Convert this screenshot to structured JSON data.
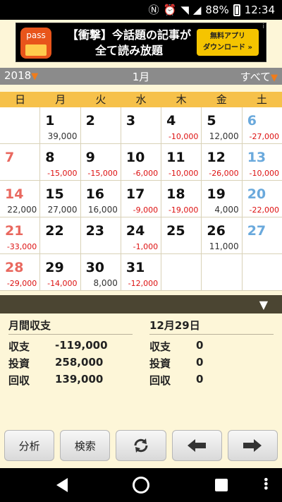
{
  "status": {
    "battery": "88%",
    "time": "12:34"
  },
  "ad": {
    "logo_text": "pass",
    "line1": "【衝撃】今話題の記事が",
    "line2": "全て読み放題",
    "button_line1": "無料アプリ",
    "button_line2": "ダウンロード »",
    "info": "i"
  },
  "header": {
    "year": "2018",
    "month": "1月",
    "filter": "すべて"
  },
  "weekdays": [
    "日",
    "月",
    "火",
    "水",
    "木",
    "金",
    "土"
  ],
  "calendar": [
    [
      {
        "day": "",
        "amount": ""
      },
      {
        "day": "1",
        "amount": "39,000"
      },
      {
        "day": "2",
        "amount": ""
      },
      {
        "day": "3",
        "amount": ""
      },
      {
        "day": "4",
        "amount": "-10,000"
      },
      {
        "day": "5",
        "amount": "12,000"
      },
      {
        "day": "6",
        "amount": "-27,000"
      }
    ],
    [
      {
        "day": "7",
        "amount": ""
      },
      {
        "day": "8",
        "amount": "-15,000"
      },
      {
        "day": "9",
        "amount": "-15,000"
      },
      {
        "day": "10",
        "amount": "-6,000"
      },
      {
        "day": "11",
        "amount": "-10,000"
      },
      {
        "day": "12",
        "amount": "-26,000"
      },
      {
        "day": "13",
        "amount": "-10,000"
      }
    ],
    [
      {
        "day": "14",
        "amount": "22,000"
      },
      {
        "day": "15",
        "amount": "27,000"
      },
      {
        "day": "16",
        "amount": "16,000"
      },
      {
        "day": "17",
        "amount": "-9,000"
      },
      {
        "day": "18",
        "amount": "-19,000"
      },
      {
        "day": "19",
        "amount": "4,000"
      },
      {
        "day": "20",
        "amount": "-22,000"
      }
    ],
    [
      {
        "day": "21",
        "amount": "-33,000"
      },
      {
        "day": "22",
        "amount": ""
      },
      {
        "day": "23",
        "amount": ""
      },
      {
        "day": "24",
        "amount": "-1,000"
      },
      {
        "day": "25",
        "amount": ""
      },
      {
        "day": "26",
        "amount": "11,000"
      },
      {
        "day": "27",
        "amount": ""
      }
    ],
    [
      {
        "day": "28",
        "amount": "-29,000"
      },
      {
        "day": "29",
        "amount": "-14,000"
      },
      {
        "day": "30",
        "amount": "8,000"
      },
      {
        "day": "31",
        "amount": "-12,000"
      },
      {
        "day": "",
        "amount": ""
      },
      {
        "day": "",
        "amount": ""
      },
      {
        "day": "",
        "amount": ""
      }
    ]
  ],
  "summary_month": {
    "title": "月間収支",
    "rows": [
      {
        "label": "収支",
        "value": "-119,000"
      },
      {
        "label": "投資",
        "value": "258,000"
      },
      {
        "label": "回収",
        "value": "139,000"
      }
    ]
  },
  "summary_day": {
    "title": "12月29日",
    "rows": [
      {
        "label": "収支",
        "value": "0"
      },
      {
        "label": "投資",
        "value": "0"
      },
      {
        "label": "回収",
        "value": "0"
      }
    ]
  },
  "toolbar": {
    "analyze": "分析",
    "search": "検索"
  },
  "colors": {
    "sunday": "#e9685f",
    "saturday": "#6aa9dc",
    "negative": "#dd1111",
    "weekday_bar": "#f6c14a",
    "accent": "#f07c1b"
  }
}
